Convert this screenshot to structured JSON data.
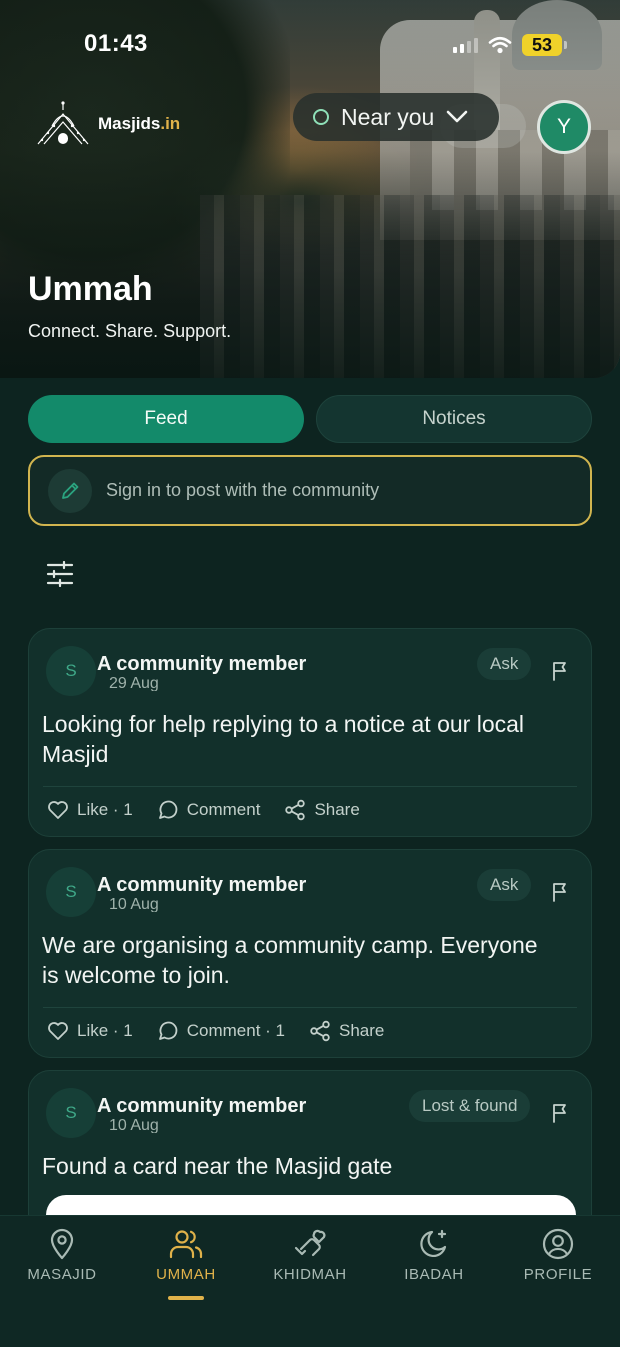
{
  "status_bar": {
    "time": "01:43",
    "battery": "53"
  },
  "header": {
    "logo_text": "Masjids",
    "logo_tld": ".in",
    "location_label": "Near you",
    "avatar_initial": "Y",
    "title": "Ummah",
    "subtitle": "Connect. Share. Support."
  },
  "tabs": [
    {
      "label": "Feed",
      "active": true
    },
    {
      "label": "Notices",
      "active": false
    }
  ],
  "composer": {
    "placeholder": "Sign in to post with the community"
  },
  "posts": [
    {
      "avatar_initial": "S",
      "author": "A community member",
      "date": "29 Aug",
      "tag": "Ask",
      "body": "Looking for help replying to a notice at our local Masjid",
      "like_label": "Like · 1",
      "comment_label": "Comment",
      "share_label": "Share"
    },
    {
      "avatar_initial": "S",
      "author": "A community member",
      "date": "10 Aug",
      "tag": "Ask",
      "body": "We are organising a community camp. Everyone is welcome to join.",
      "like_label": "Like · 1",
      "comment_label": "Comment · 1",
      "share_label": "Share"
    },
    {
      "avatar_initial": "S",
      "author": "A community member",
      "date": "10 Aug",
      "tag": "Lost & found",
      "body": "Found a card near the Masjid gate"
    }
  ],
  "bottom_nav": [
    {
      "label": "MASAJID",
      "icon": "map-pin-icon",
      "active": false
    },
    {
      "label": "UMMAH",
      "icon": "users-icon",
      "active": true
    },
    {
      "label": "KHIDMAH",
      "icon": "helping-hand-icon",
      "active": false
    },
    {
      "label": "IBADAH",
      "icon": "moon-star-icon",
      "active": false
    },
    {
      "label": "PROFILE",
      "icon": "user-circle-icon",
      "active": false
    }
  ],
  "colors": {
    "background": "#0d2420",
    "accent_green": "#138a6a",
    "accent_gold": "#e0b24a",
    "card": "#12302b"
  }
}
